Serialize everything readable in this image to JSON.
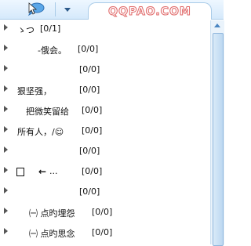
{
  "toolbar": {
    "status_icon": "chat-bubble-icon",
    "menu_icon": "dropdown-arrow-icon"
  },
  "tab": {
    "watermark_text": "QQPAO.COM"
  },
  "colors": {
    "accent": "#a9cbe8",
    "watermark": "#e06a6a",
    "scroll": "#4b86c2"
  },
  "groups": [
    {
      "name": "ゝつ",
      "count": "[0/1]"
    },
    {
      "name": "-俄会。",
      "count": "[0/0]"
    },
    {
      "name": "",
      "count": "[0/0]"
    },
    {
      "name": "狠坚强，",
      "count": "[0/0]"
    },
    {
      "name": "把微笑留给",
      "count": "[0/0]"
    },
    {
      "name": "所有人，/☺",
      "count": "[0/0]"
    },
    {
      "name": "",
      "count": "[0/0]"
    },
    {
      "name": "",
      "arrow": "←",
      "ellipsis": "...",
      "count": "[0/0]"
    },
    {
      "name": "",
      "count": "[0/0]"
    },
    {
      "name": "㈠ 点旳埋怨",
      "count": "[0/0]"
    },
    {
      "name": "㈠ 点旳思念",
      "count": "[0/0]"
    }
  ]
}
